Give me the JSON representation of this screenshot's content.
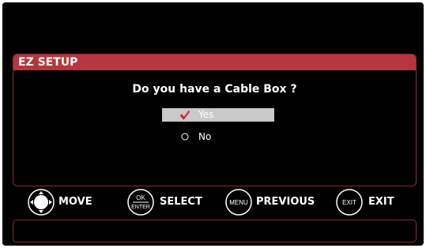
{
  "dialog": {
    "title": "EZ SETUP",
    "question": "Do you have a Cable Box ?",
    "options": [
      {
        "label": "Yes",
        "selected": true
      },
      {
        "label": "No",
        "selected": false
      }
    ]
  },
  "legend": {
    "move": {
      "label": "MOVE",
      "icon": "dpad-icon"
    },
    "select": {
      "label": "SELECT",
      "icon_top": "OK",
      "icon_bottom": "ENTER"
    },
    "previous": {
      "label": "PREVIOUS",
      "icon_text": "MENU"
    },
    "exit": {
      "label": "EXIT",
      "icon_text": "EXIT"
    }
  },
  "colors": {
    "accent": "#b7353f",
    "border": "#8c2a31",
    "selected_bg": "#c9c9c9",
    "check": "#c0242f"
  }
}
